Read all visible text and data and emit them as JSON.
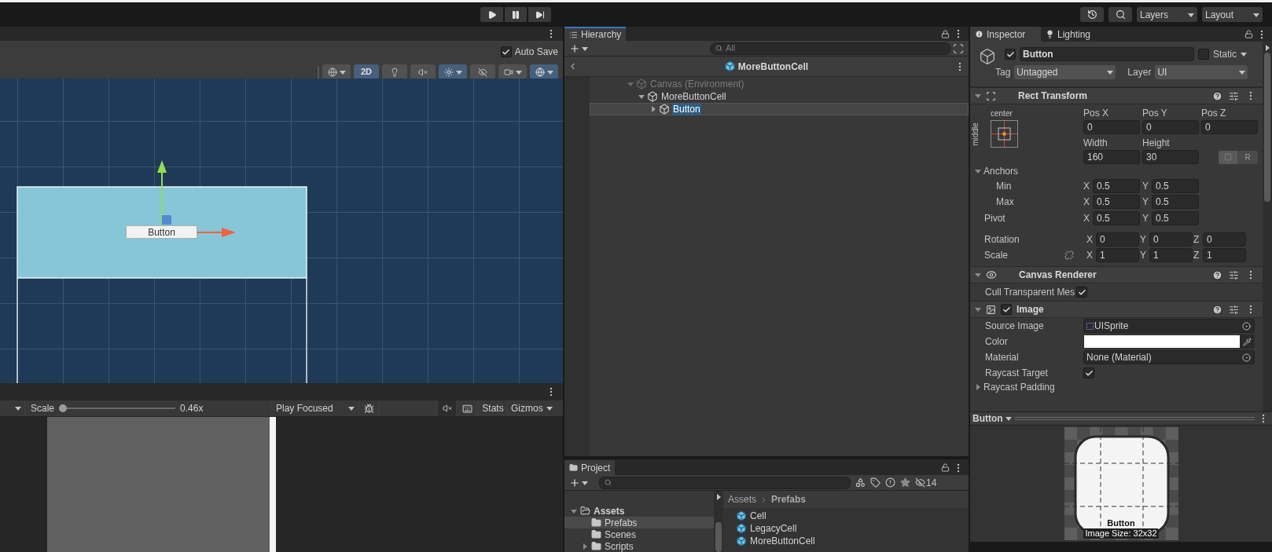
{
  "toolbar": {
    "layers": "Layers",
    "layout": "Layout"
  },
  "scene": {
    "auto_save": {
      "label": "Auto Save",
      "checked": true
    },
    "tools": [
      {
        "kind": "shading",
        "on": false
      },
      {
        "kind": "mode",
        "label": "2D",
        "on": true
      },
      {
        "kind": "lighting",
        "on": false
      },
      {
        "kind": "audio",
        "on": false
      },
      {
        "kind": "effects",
        "on": true
      },
      {
        "kind": "visibility",
        "on": false
      },
      {
        "kind": "camera",
        "on": false
      },
      {
        "kind": "gizmos",
        "on": true
      }
    ],
    "object_label": "Button"
  },
  "game": {
    "scale_label": "Scale",
    "scale": {
      "level": 0.0
    },
    "scale_value": "0.46x",
    "play_mode": "Play Focused",
    "mute": {
      "on": true
    },
    "stats": "Stats",
    "gizmos": "Gizmos"
  },
  "hierarchy": {
    "tab": {
      "label": "Hierarchy",
      "selected": true
    },
    "search": {
      "placeholder": "All"
    },
    "prefab_title": "MoreButtonCell",
    "tree": [
      {
        "label": "Canvas (Environment)",
        "dimmed": true,
        "expanded": true,
        "selected": false,
        "children": [
          {
            "label": "MoreButtonCell",
            "dimmed": false,
            "expanded": true,
            "selected": false,
            "children": [
              {
                "label": "Button",
                "dimmed": false,
                "expanded": false,
                "selected": true
              }
            ]
          }
        ]
      }
    ]
  },
  "project": {
    "tab": {
      "label": "Project",
      "selected": true
    },
    "hidden_count": "14",
    "folders": [
      {
        "label": "Assets",
        "expanded": true,
        "selected": false,
        "children": [
          {
            "label": "Prefabs",
            "selected": true
          },
          {
            "label": "Scenes",
            "selected": false
          },
          {
            "label": "Scripts",
            "selected": false,
            "expanded": false
          }
        ]
      }
    ],
    "breadcrumb": [
      "Assets",
      "Prefabs"
    ],
    "files": [
      "Cell",
      "LegacyCell",
      "MoreButtonCell"
    ]
  },
  "inspector": {
    "tabs": [
      {
        "label": "Inspector",
        "selected": true
      },
      {
        "label": "Lighting",
        "selected": false
      }
    ],
    "object": {
      "active": true,
      "name": "Button",
      "static": {
        "label": "Static",
        "checked": false
      },
      "tag": {
        "label": "Tag",
        "value": "Untagged"
      },
      "layer": {
        "label": "Layer",
        "value": "UI"
      }
    },
    "rect_transform": {
      "title": "Rect Transform",
      "expanded": true,
      "anchor_h": "center",
      "anchor_v": "middle",
      "position": [
        {
          "label": "Pos X",
          "value": "0"
        },
        {
          "label": "Pos Y",
          "value": "0"
        },
        {
          "label": "Pos Z",
          "value": "0"
        }
      ],
      "size": [
        {
          "label": "Width",
          "value": "160"
        },
        {
          "label": "Height",
          "value": "30"
        }
      ],
      "raw_button": "R",
      "anchors": {
        "label": "Anchors",
        "expanded": true,
        "rows": [
          {
            "label": "Min",
            "fields": [
              {
                "axis": "X",
                "value": "0.5"
              },
              {
                "axis": "Y",
                "value": "0.5"
              }
            ]
          },
          {
            "label": "Max",
            "fields": [
              {
                "axis": "X",
                "value": "0.5"
              },
              {
                "axis": "Y",
                "value": "0.5"
              }
            ]
          }
        ]
      },
      "pivot": {
        "label": "Pivot",
        "fields": [
          {
            "axis": "X",
            "value": "0.5"
          },
          {
            "axis": "Y",
            "value": "0.5"
          }
        ]
      },
      "vectors": [
        {
          "label": "Rotation",
          "fields": [
            {
              "axis": "X",
              "value": "0"
            },
            {
              "axis": "Y",
              "value": "0"
            },
            {
              "axis": "Z",
              "value": "0"
            }
          ]
        },
        {
          "label": "Scale",
          "fields": [
            {
              "axis": "X",
              "value": "1"
            },
            {
              "axis": "Y",
              "value": "1"
            },
            {
              "axis": "Z",
              "value": "1"
            }
          ]
        }
      ]
    },
    "canvas_renderer": {
      "title": "Canvas Renderer",
      "expanded": true,
      "cull": {
        "label": "Cull Transparent Mes",
        "checked": true
      }
    },
    "image": {
      "title": "Image",
      "expanded": true,
      "enabled": true,
      "properties": [
        {
          "kind": "object",
          "label": "Source Image",
          "value": "UISprite"
        },
        {
          "kind": "color",
          "label": "Color",
          "color": "#ffffff"
        },
        {
          "kind": "object",
          "label": "Material",
          "value": "None (Material)"
        },
        {
          "kind": "toggle",
          "label": "Raycast Target",
          "checked": true
        },
        {
          "kind": "foldout",
          "label": "Raycast Padding",
          "expanded": false
        }
      ]
    },
    "preview": {
      "title": "Button",
      "label": "Button",
      "size": "Image Size: 32x32"
    }
  }
}
